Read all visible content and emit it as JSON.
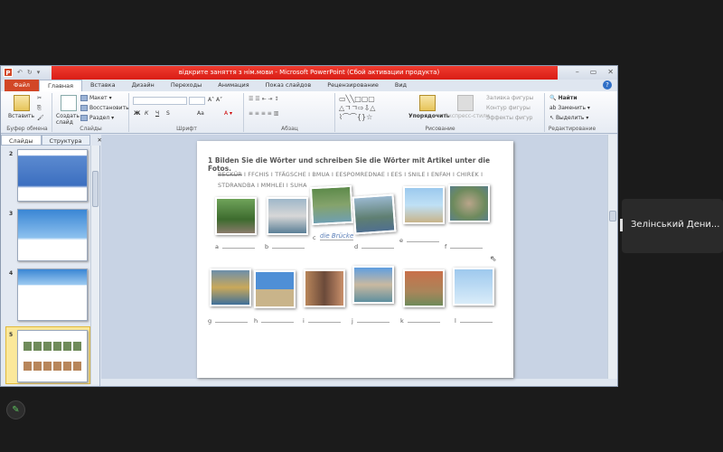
{
  "window": {
    "title": "відкрите заняття з нім.мови - Microsoft PowerPoint (Сбой активации продукта)",
    "app_icon": "P"
  },
  "ribbon_tabs": [
    "Файл",
    "Главная",
    "Вставка",
    "Дизайн",
    "Переходы",
    "Анимация",
    "Показ слайдов",
    "Рецензирование",
    "Вид"
  ],
  "active_tab": "Главная",
  "groups": {
    "clipboard": {
      "label": "Буфер обмена",
      "paste": "Вставить"
    },
    "slides": {
      "label": "Слайды",
      "new_slide": "Создать слайд",
      "layout": "Макет",
      "reset": "Восстановить",
      "section": "Раздел"
    },
    "font": {
      "label": "Шрифт",
      "bold": "Ж",
      "italic": "К",
      "underline": "Ч",
      "strike": "S",
      "case": "Aa"
    },
    "paragraph": {
      "label": "Абзац"
    },
    "drawing": {
      "label": "Рисование",
      "arrange": "Упорядочить",
      "quick_styles": "Экспресс-стили",
      "fill": "Заливка фигуры",
      "outline": "Контур фигуры",
      "effects": "Эффекты фигур"
    },
    "editing": {
      "label": "Редактирование",
      "find": "Найти",
      "replace": "Заменить",
      "select": "Выделить"
    }
  },
  "pane_tabs": [
    "Слайды",
    "Структура"
  ],
  "thumbnails": [
    {
      "num": "2"
    },
    {
      "num": "3"
    },
    {
      "num": "4"
    },
    {
      "num": "5",
      "selected": true
    }
  ],
  "slide": {
    "heading": "1  Bilden Sie die Wörter und schreiben Sie die Wörter mit Artikel unter die Fotos.",
    "struck_word": "BECKÜR",
    "words": "  I  FFCHIS  I  TFÄGSCHE  I  BMUA  I  EESPOMREDNAE  I  EES  I  SNILE  I  ENFAH  I  CHIREK  I  STDRANDBA  I  MMHLEI  I  SUHA",
    "handwritten": "die Brücke",
    "labels_row1": [
      "a",
      "b",
      "c",
      "d",
      "e",
      "f"
    ],
    "labels_row2": [
      "g",
      "h",
      "i",
      "j",
      "k",
      "l"
    ]
  },
  "participant": {
    "name": "Зелінський Дени..."
  }
}
